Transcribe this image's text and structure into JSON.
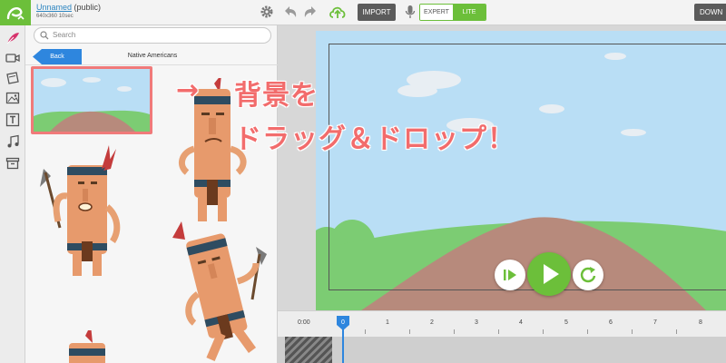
{
  "header": {
    "project_name": "Unnamed",
    "project_visibility": "(public)",
    "project_meta": "640x360  10sec",
    "import_label": "IMPORT",
    "mode_expert_label": "EXPERT",
    "mode_lite_label": "LITE",
    "mode_selected": "LITE",
    "download_label": "DOWN"
  },
  "library": {
    "search_placeholder": "Search",
    "back_label": "Back",
    "breadcrumb": "Native Americans"
  },
  "timeline": {
    "start_label": "0:00",
    "ticks": [
      "0",
      "1",
      "2",
      "3",
      "4",
      "5",
      "6",
      "7",
      "8"
    ],
    "playhead_label": "0"
  },
  "annotation": {
    "arrow": "→",
    "line1": "背景を",
    "line2": "ドラッグ＆ドロップ！"
  },
  "colors": {
    "brand_green": "#6cbf3a",
    "accent_blue": "#2e86de",
    "annotation_red": "#f26c6c",
    "sky": "#b9def5",
    "grass": "#7ccc73",
    "dirt": "#b78a7c"
  }
}
